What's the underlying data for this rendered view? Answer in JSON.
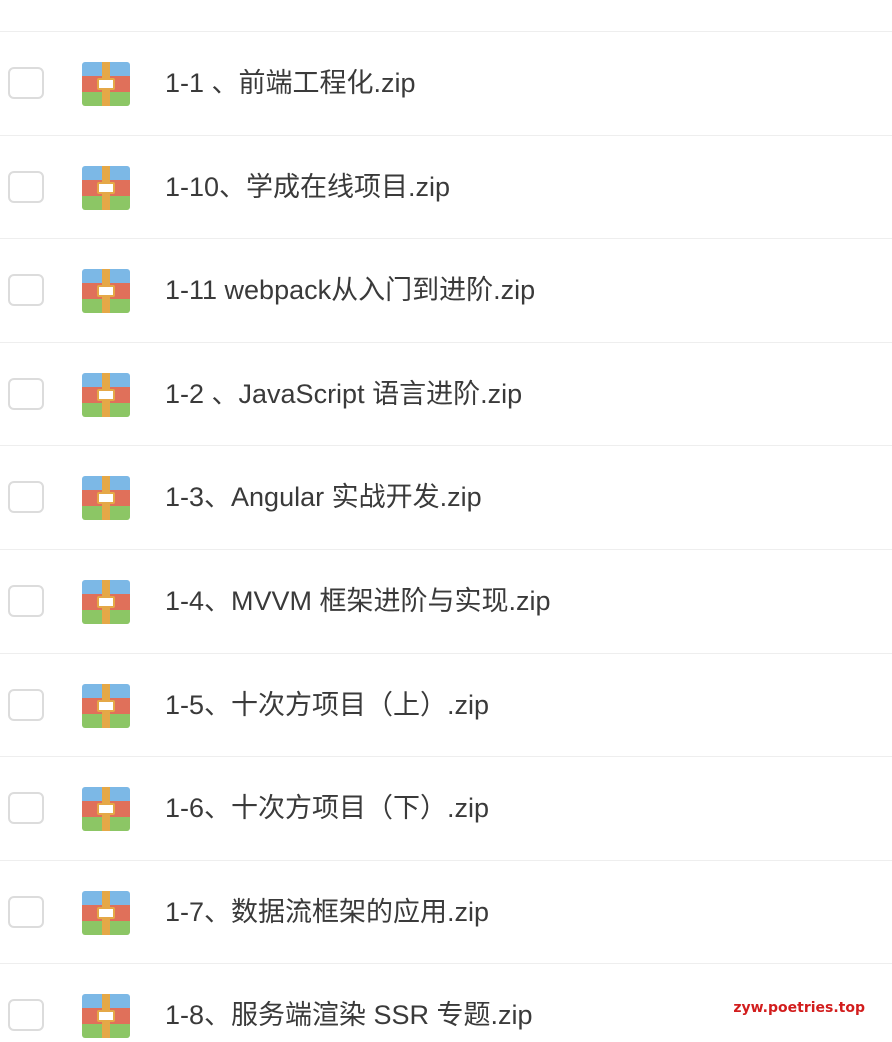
{
  "top_link": {
    "label": ""
  },
  "files": [
    {
      "name": "1-1 、前端工程化.zip",
      "icon": "zip-archive-icon"
    },
    {
      "name": "1-10、学成在线项目.zip",
      "icon": "zip-archive-icon"
    },
    {
      "name": "1-11 webpack从入门到进阶.zip",
      "icon": "zip-archive-icon"
    },
    {
      "name": "1-2 、JavaScript 语言进阶.zip",
      "icon": "zip-archive-icon"
    },
    {
      "name": "1-3、Angular 实战开发.zip",
      "icon": "zip-archive-icon"
    },
    {
      "name": "1-4、MVVM 框架进阶与实现.zip",
      "icon": "zip-archive-icon"
    },
    {
      "name": "1-5、十次方项目（上）.zip",
      "icon": "zip-archive-icon"
    },
    {
      "name": "1-6、十次方项目（下）.zip",
      "icon": "zip-archive-icon"
    },
    {
      "name": "1-7、数据流框架的应用.zip",
      "icon": "zip-archive-icon"
    },
    {
      "name": "1-8、服务端渲染 SSR 专题.zip",
      "icon": "zip-archive-icon"
    }
  ],
  "watermark": "zyw.poetries.top",
  "colors": {
    "icon_top": "#7cb8e6",
    "icon_middle": "#e0705a",
    "icon_bottom": "#8cc665",
    "icon_strap": "#e5a847",
    "watermark": "#d21d1d"
  }
}
